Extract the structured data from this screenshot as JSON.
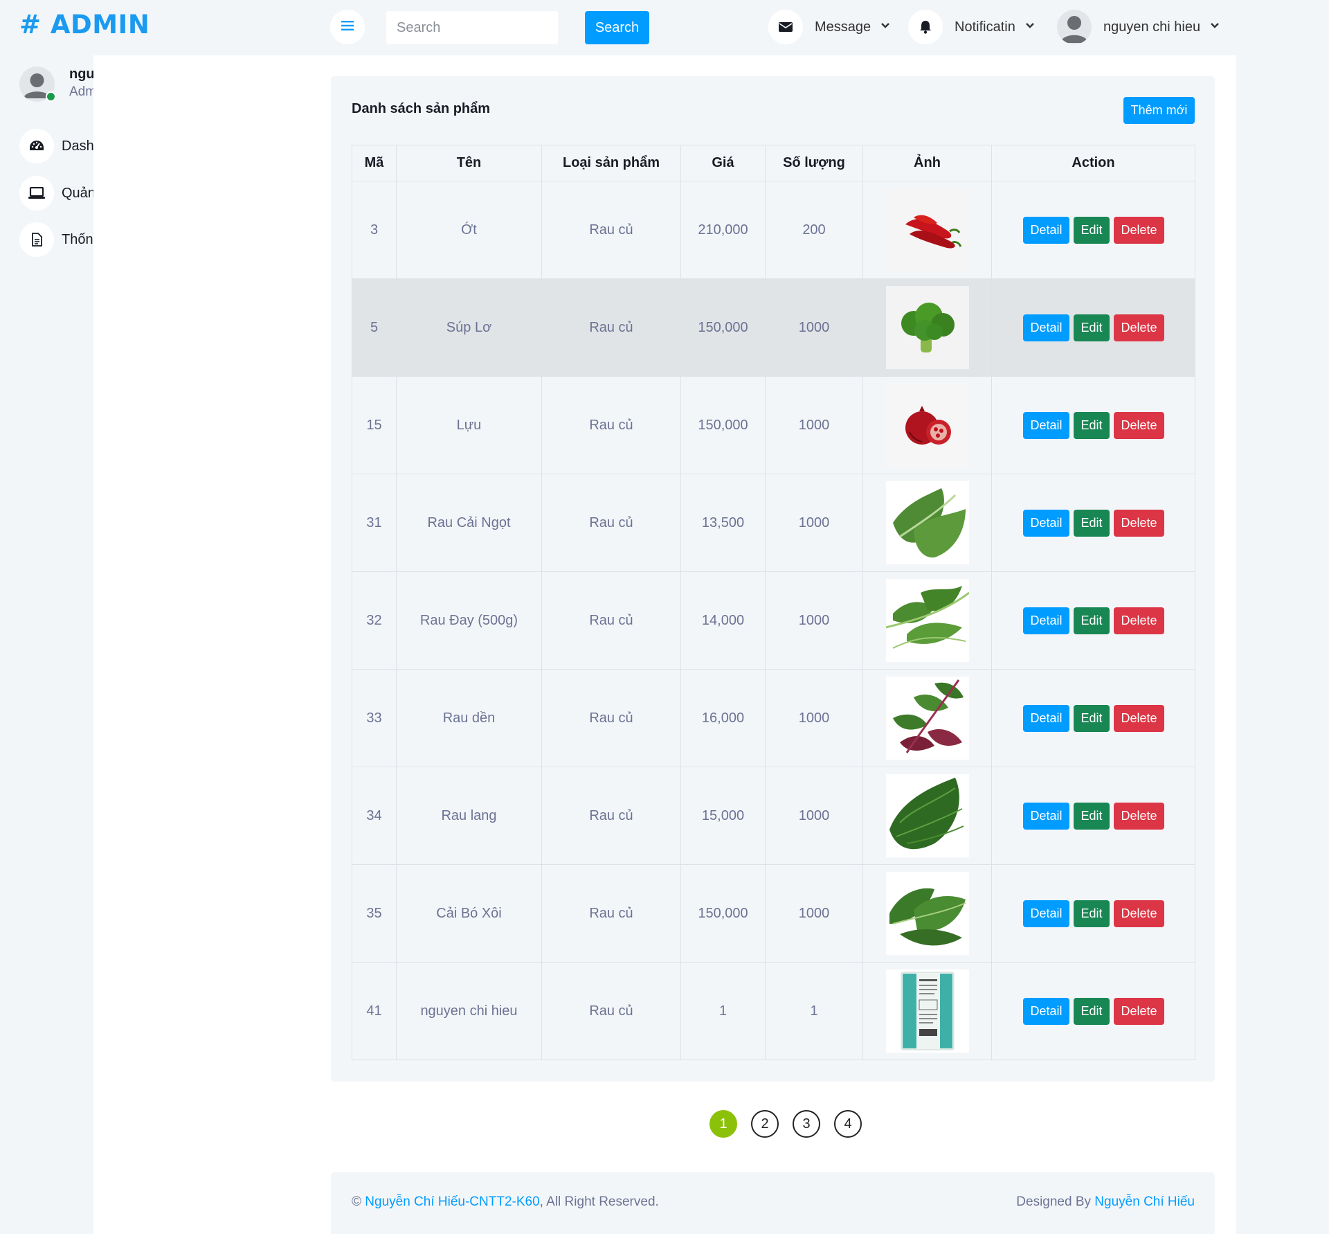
{
  "sidebar": {
    "brand": "# ADMIN",
    "user_name": "nguyen chi hieu",
    "user_role": "Admin",
    "items": [
      {
        "label": "Dashboard",
        "icon": "gauge-icon"
      },
      {
        "label": "Quản lý",
        "icon": "laptop-icon"
      },
      {
        "label": "Thống kê",
        "icon": "document-icon"
      }
    ]
  },
  "topbar": {
    "search_placeholder": "Search",
    "search_button": "Search",
    "message_label": "Message",
    "notification_label": "Notificatin",
    "user_label": "nguyen chi hieu"
  },
  "card": {
    "title": "Danh sách sản phẩm",
    "add_button": "Thêm mới"
  },
  "table": {
    "headers": [
      "Mã",
      "Tên",
      "Loại sản phẩm",
      "Giá",
      "Số lượng",
      "Ảnh",
      "Action"
    ],
    "actions": {
      "detail": "Detail",
      "edit": "Edit",
      "delete": "Delete"
    },
    "rows": [
      {
        "id": "3",
        "name": "Ớt",
        "category": "Rau củ",
        "price": "210,000",
        "qty": "200",
        "image": "chili"
      },
      {
        "id": "5",
        "name": "Súp Lơ",
        "category": "Rau củ",
        "price": "150,000",
        "qty": "1000",
        "image": "broccoli"
      },
      {
        "id": "15",
        "name": "Lựu",
        "category": "Rau củ",
        "price": "150,000",
        "qty": "1000",
        "image": "pomegranate"
      },
      {
        "id": "31",
        "name": "Rau Cải Ngọt",
        "category": "Rau củ",
        "price": "13,500",
        "qty": "1000",
        "image": "greens"
      },
      {
        "id": "32",
        "name": "Rau Đay (500g)",
        "category": "Rau củ",
        "price": "14,000",
        "qty": "1000",
        "image": "greens-leafy"
      },
      {
        "id": "33",
        "name": "Rau dền",
        "category": "Rau củ",
        "price": "16,000",
        "qty": "1000",
        "image": "amaranth"
      },
      {
        "id": "34",
        "name": "Rau lang",
        "category": "Rau củ",
        "price": "15,000",
        "qty": "1000",
        "image": "greens-dark"
      },
      {
        "id": "35",
        "name": "Cải Bó Xôi",
        "category": "Rau củ",
        "price": "150,000",
        "qty": "1000",
        "image": "spinach"
      },
      {
        "id": "41",
        "name": "nguyen chi hieu",
        "category": "Rau củ",
        "price": "1",
        "qty": "1",
        "image": "package"
      }
    ]
  },
  "pagination": {
    "pages": [
      "1",
      "2",
      "3",
      "4"
    ],
    "current": "1"
  },
  "footer": {
    "copyright_symbol": "©",
    "author_link": "Nguyễn Chí Hiếu-CNTT2-K60",
    "rights": ", All Right Reserved.",
    "designed_by": "Designed By",
    "designer_link": "Nguyễn Chí Hiếu"
  },
  "colors": {
    "accent": "#009cff",
    "edit": "#198754",
    "delete": "#dc3545",
    "page_active": "#8cc10a",
    "online": "#1a9a4a"
  }
}
